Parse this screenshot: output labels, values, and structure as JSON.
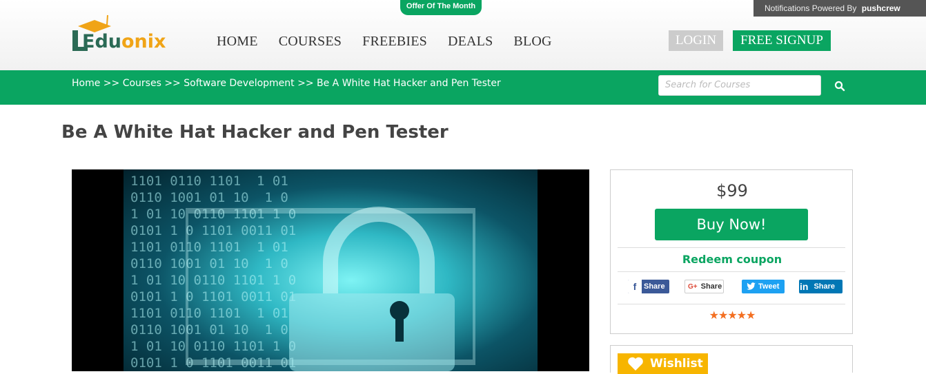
{
  "header": {
    "offer_badge": "Offer Of The Month",
    "notifications": {
      "text": "Notifications Powered By",
      "brand": "pushcrew"
    },
    "logo": {
      "part1": "Edu",
      "part2": "onix"
    },
    "nav": [
      "HOME",
      "COURSES",
      "FREEBIES",
      "DEALS",
      "BLOG"
    ],
    "login_label": "LOGIN",
    "signup_label": "FREE SIGNUP"
  },
  "breadcrumb": {
    "text": "Home >> Courses >> Software Development >> Be A White Hat Hacker and Pen Tester"
  },
  "search": {
    "placeholder": "Search for Courses"
  },
  "page": {
    "title": "Be A White Hat Hacker and Pen Tester"
  },
  "purchase": {
    "price": "$99",
    "buy_label": "Buy Now!",
    "redeem_label": "Redeem coupon",
    "share": {
      "facebook": "Share",
      "google": "Share",
      "twitter": "Tweet",
      "linkedin": "Share"
    },
    "stars": "★★★★★",
    "rating": 5
  },
  "wishlist": {
    "label": "Wishlist"
  },
  "colors": {
    "brand_green": "#0aa561",
    "wishlist_yellow": "#f7b500",
    "star_orange": "#f36f21"
  }
}
